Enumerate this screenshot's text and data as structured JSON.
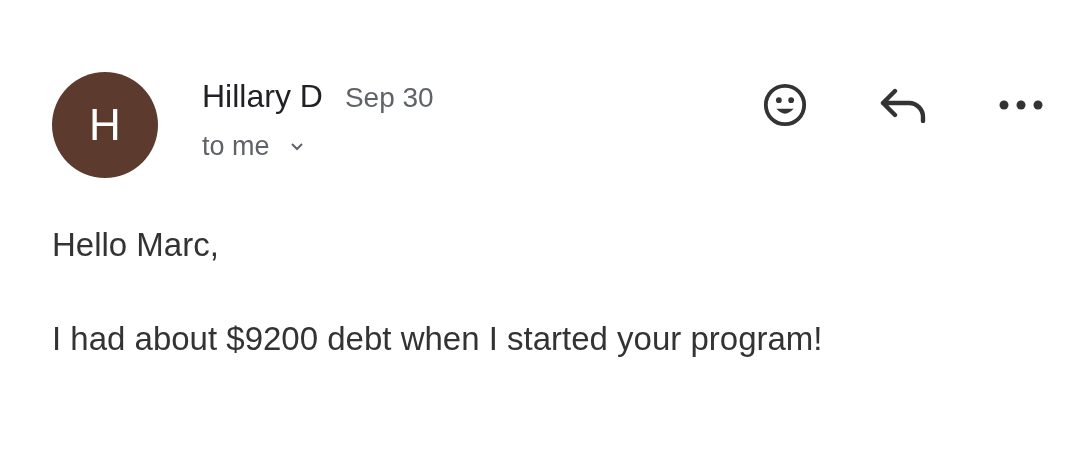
{
  "message": {
    "avatar_letter": "H",
    "sender": "Hillary D",
    "date": "Sep 30",
    "recipient": "to me",
    "expanded": false,
    "body": [
      "Hello Marc,",
      "I had about $9200 debt when I started your program!"
    ]
  }
}
